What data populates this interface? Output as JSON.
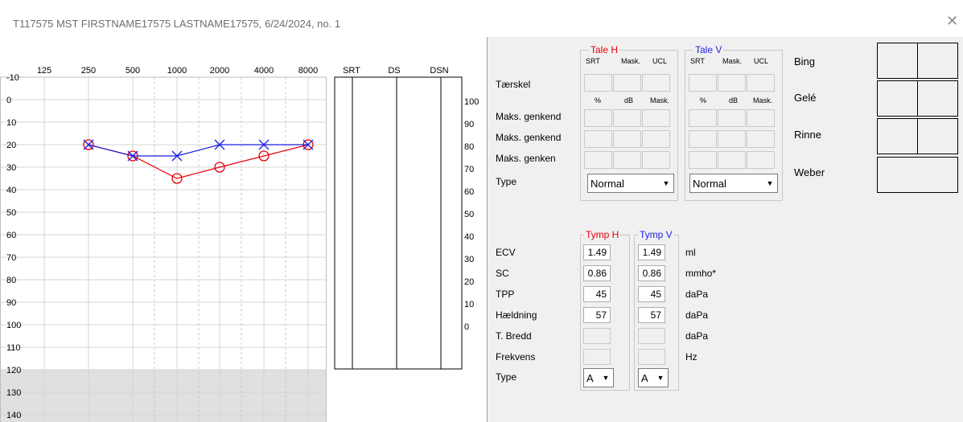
{
  "window": {
    "title": "T117575 MST FIRSTNAME17575 LASTNAME17575, 6/24/2024, no. 1",
    "close_icon": "close-icon"
  },
  "audiogram": {
    "frequencies": [
      "125",
      "250",
      "500",
      "1000",
      "2000",
      "4000",
      "8000"
    ],
    "db_levels": [
      "-10",
      "0",
      "10",
      "20",
      "30",
      "40",
      "50",
      "60",
      "70",
      "80",
      "90",
      "100",
      "110",
      "120",
      "130",
      "140"
    ],
    "right_scale": [
      "100",
      "90",
      "80",
      "70",
      "60",
      "50",
      "40",
      "30",
      "20",
      "10",
      "0"
    ],
    "speech_columns": [
      "SRT",
      "DS",
      "DSN"
    ],
    "right_ear_color": "#e8000b",
    "left_ear_color": "#1f1fe0",
    "gray_region_color": "#e0e0e0"
  },
  "chart_data": {
    "type": "line",
    "xlabel": "",
    "ylabel": "",
    "x": [
      "250",
      "500",
      "1000",
      "2000",
      "4000",
      "8000"
    ],
    "ylim": [
      -10,
      140
    ],
    "y_inverted": true,
    "series": [
      {
        "marker": "circle",
        "color": "#e8000b",
        "values": [
          20,
          25,
          35,
          30,
          25,
          20
        ]
      },
      {
        "marker": "cross",
        "color": "#1f1fe0",
        "values": [
          20,
          25,
          25,
          20,
          20,
          20
        ]
      }
    ]
  },
  "speech": {
    "right_title": "Tale H",
    "left_title": "Tale V",
    "right_color": "#e8000b",
    "left_color": "#1f1fe0",
    "col_headers_top": [
      "SRT",
      "Mask.",
      "UCL"
    ],
    "col_headers_bottom": [
      "%",
      "dB",
      "Mask."
    ],
    "rows": [
      "Tærskel",
      "Maks. genkend",
      "Maks. genkend",
      "Maks. genken"
    ],
    "type_label": "Type",
    "type_right": "Normal",
    "type_left": "Normal"
  },
  "tests": {
    "bing": "Bing",
    "gele": "Gelé",
    "rinne": "Rinne",
    "weber": "Weber"
  },
  "tymp": {
    "right_title": "Tymp H",
    "left_title": "Tymp V",
    "rows": [
      {
        "label": "ECV",
        "right": "1.49",
        "left": "1.49",
        "unit": "ml"
      },
      {
        "label": " SC",
        "right": "0.86",
        "left": "0.86",
        "unit": "mmho*"
      },
      {
        "label": "TPP",
        "right": "45",
        "left": "45",
        "unit": "daPa"
      },
      {
        "label": "Hældning",
        "right": "57",
        "left": "57",
        "unit": "daPa"
      },
      {
        "label": "T. Bredd",
        "right": "",
        "left": "",
        "unit": "daPa"
      },
      {
        "label": "Frekvens",
        "right": "",
        "left": "",
        "unit": "Hz"
      }
    ],
    "type_label": "Type",
    "type_right": "A",
    "type_left": "A"
  }
}
